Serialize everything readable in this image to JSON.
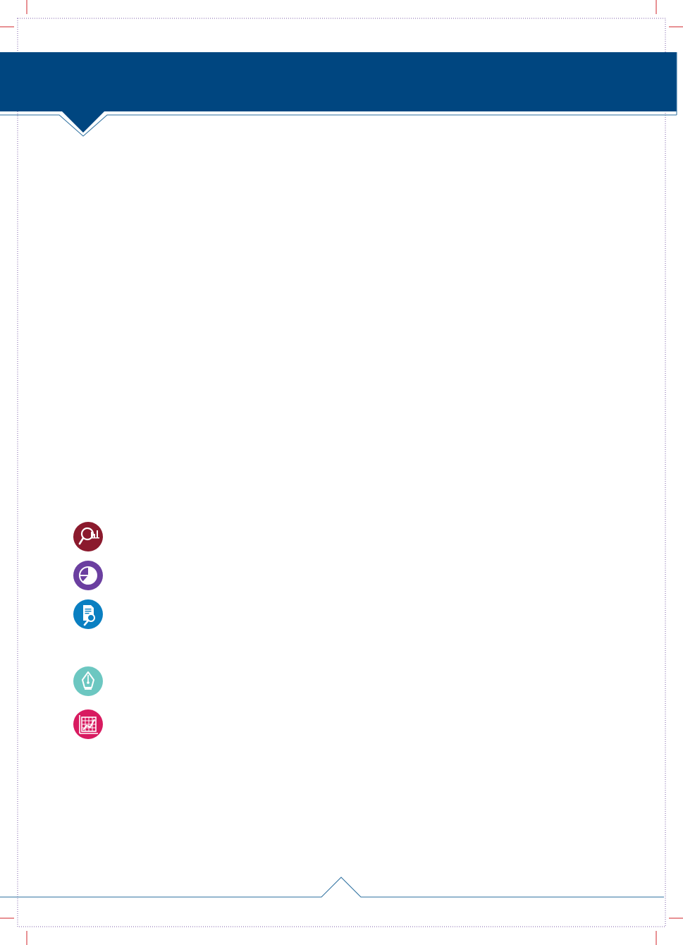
{
  "colors": {
    "header_blue": "#004680",
    "crop_mark_red": "#d2232a",
    "rule_blue": "#2a6e9e",
    "trim_purple": "#7b5ea7"
  },
  "icons": [
    {
      "name": "magnifier-bar-chart-icon",
      "color": "#8b1a2d"
    },
    {
      "name": "pie-chart-icon",
      "color": "#6b3fa0"
    },
    {
      "name": "document-search-icon",
      "color": "#0a7fc1"
    },
    {
      "name": "pen-nib-icon",
      "color": "#6cc7c1"
    },
    {
      "name": "grid-chart-icon",
      "color": "#d81b60"
    }
  ]
}
